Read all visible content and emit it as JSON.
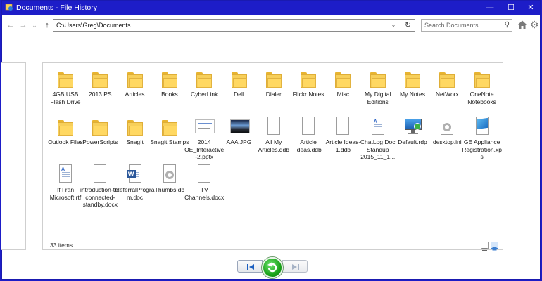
{
  "window": {
    "title": "Documents - File History",
    "minimize_glyph": "—",
    "maximize_glyph": "☐",
    "close_glyph": "✕"
  },
  "nav": {
    "back_glyph": "←",
    "forward_glyph": "→",
    "recent_glyph": "⌄",
    "up_glyph": "↑",
    "address": "C:\\Users\\Greg\\Documents",
    "dropdown_glyph": "⌄",
    "refresh_glyph": "↻",
    "search_placeholder": "Search Documents",
    "search_icon_glyph": "⚲",
    "settings_glyph": "⚙"
  },
  "items": [
    {
      "label": "4GB USB Flash Drive",
      "type": "folder"
    },
    {
      "label": "2013 PS",
      "type": "folder"
    },
    {
      "label": "Articles",
      "type": "folder"
    },
    {
      "label": "Books",
      "type": "folder"
    },
    {
      "label": "CyberLink",
      "type": "folder"
    },
    {
      "label": "Dell",
      "type": "folder"
    },
    {
      "label": "Dialer",
      "type": "folder"
    },
    {
      "label": "Flickr Notes",
      "type": "folder"
    },
    {
      "label": "Misc",
      "type": "folder"
    },
    {
      "label": "My Digital Editions",
      "type": "folder"
    },
    {
      "label": "My Notes",
      "type": "folder"
    },
    {
      "label": "NetWorx",
      "type": "folder"
    },
    {
      "label": "OneNote Notebooks",
      "type": "folder"
    },
    {
      "label": "Outlook Files",
      "type": "folder"
    },
    {
      "label": "PowerScripts",
      "type": "folder"
    },
    {
      "label": "SnagIt",
      "type": "folder"
    },
    {
      "label": "Snagit Stamps",
      "type": "folder"
    },
    {
      "label": "2014 OE_Interactive-2.pptx",
      "type": "pptx"
    },
    {
      "label": "AAA.JPG",
      "type": "jpg"
    },
    {
      "label": "All My Articles.ddb",
      "type": "file"
    },
    {
      "label": "Article Ideas.ddb",
      "type": "file"
    },
    {
      "label": "Article Ideas-1.ddb",
      "type": "file"
    },
    {
      "label": "ChatLog Doc Standup 2015_11_1...",
      "type": "rtf"
    },
    {
      "label": "Default.rdp",
      "type": "rdp"
    },
    {
      "label": "desktop.ini",
      "type": "ini"
    },
    {
      "label": "GE Appliance Registration.xps",
      "type": "xps"
    },
    {
      "label": "If I ran Microsoft.rtf",
      "type": "rtf"
    },
    {
      "label": "introduction-to-connected-standby.docx",
      "type": "file"
    },
    {
      "label": "ReferralProgram.doc",
      "type": "word"
    },
    {
      "label": "Thumbs.db",
      "type": "ini"
    },
    {
      "label": "TV Channels.docx",
      "type": "file"
    }
  ],
  "status": {
    "count": "33 items"
  },
  "controls": {
    "previous_glyph": "⏮",
    "restore_glyph": "↻",
    "next_glyph": "⏭"
  },
  "colors": {
    "titlebar": "#1d1dc8",
    "folder": "#f7cf5a",
    "restore": "#1aa31a"
  }
}
